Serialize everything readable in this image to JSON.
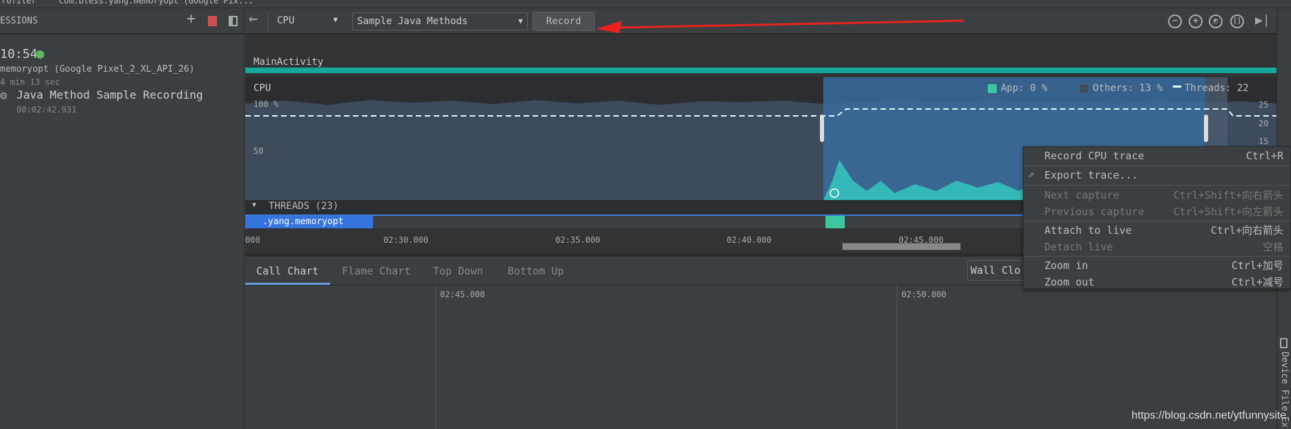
{
  "window": {
    "tab_left": "rofiler",
    "tab_session": "com.bless.yang.memoryopt (Google Pix..."
  },
  "sidebar": {
    "header": "ESSIONS",
    "add_icon": "plus-icon",
    "stop_icon": "stop-icon",
    "layout_icon": "panel-icon",
    "session": {
      "time": "10:54",
      "status_color": "#5fb85f",
      "device": "memoryopt (Google Pixel_2_XL_API_26)",
      "duration": "4 min 13 sec"
    },
    "recording": {
      "title": "Java Method Sample Recording",
      "time": "00:02:42.931"
    }
  },
  "toolbar": {
    "back_icon": "arrow-left-icon",
    "profiler": "CPU",
    "config": "Sample Java Methods",
    "record": "Record",
    "icons": [
      "zoom-out-icon",
      "zoom-in-icon",
      "reset-zoom-icon",
      "zoom-to-selection-icon",
      "go-live-icon"
    ]
  },
  "activity": {
    "label": "MainActivity",
    "color": "#14a99a"
  },
  "cpu": {
    "label": "CPU",
    "y_top": "100 %",
    "y_mid": "50",
    "right_ticks": [
      "25",
      "20",
      "15"
    ],
    "legend": {
      "app": "App: 0 %",
      "others": "Others: 13 %",
      "threads": "Threads: 22"
    },
    "app_color": "#3ec6a0",
    "others_color": "#3d4b5c",
    "selection_color": "#3a6b9e"
  },
  "threads": {
    "header": "THREADS (23)",
    "thread_name": ".yang.memoryopt"
  },
  "timeline": {
    "labels": [
      "000",
      "02:30.000",
      "02:35.000",
      "02:40.000",
      "02:45.000"
    ]
  },
  "bottom_tabs": [
    "Call Chart",
    "Flame Chart",
    "Top Down",
    "Bottom Up"
  ],
  "clock_select": "Wall Clo",
  "call_chart": {
    "labels": [
      "02:45.000",
      "02:50.000"
    ]
  },
  "context_menu": [
    {
      "label": "Record CPU trace",
      "shortcut": "Ctrl+R",
      "enabled": true
    },
    {
      "label": "Export trace...",
      "shortcut": "",
      "enabled": true,
      "icon": "export-icon"
    },
    {
      "label": "Next capture",
      "shortcut": "Ctrl+Shift+向右箭头",
      "enabled": false
    },
    {
      "label": "Previous capture",
      "shortcut": "Ctrl+Shift+向左箭头",
      "enabled": false
    },
    {
      "label": "Attach to live",
      "shortcut": "Ctrl+向右箭头",
      "enabled": true
    },
    {
      "label": "Detach live",
      "shortcut": "空格",
      "enabled": false
    },
    {
      "label": "Zoom in",
      "shortcut": "Ctrl+加号",
      "enabled": true
    },
    {
      "label": "Zoom out",
      "shortcut": "Ctrl+减号",
      "enabled": true
    }
  ],
  "right_strip": {
    "label": "Device File Ex"
  },
  "watermark": "https://blog.csdn.net/ytfunnysite"
}
